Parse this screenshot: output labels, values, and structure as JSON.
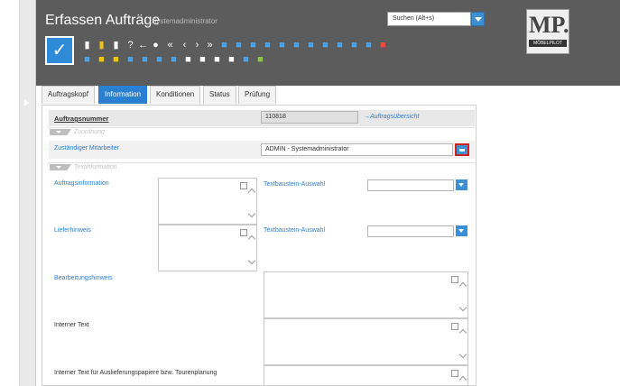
{
  "app": {
    "title": "Erfassen Aufträge",
    "subtitle": "Systemadministrator",
    "search_placeholder": "Suchen (Alt+s)",
    "logo_text": "MP.",
    "logo_wordmark": "MÖBELPILOT"
  },
  "toolbar": {
    "icons": [
      "new-icon",
      "copy-icon",
      "delete-icon",
      "help-icon",
      "back-icon",
      "search-icon",
      "first-icon",
      "previous-icon",
      "next-icon",
      "last-icon"
    ]
  },
  "tabs": [
    {
      "label": "Auftragskopf"
    },
    {
      "label": "Information"
    },
    {
      "label": "Konditionen"
    },
    {
      "label": "Status"
    },
    {
      "label": "Prüfung"
    }
  ],
  "form": {
    "order_number_label": "Auftragsnummer",
    "order_number_value": "110818",
    "order_overview_link": "→Auftragsübersicht",
    "section_assignment": "Zuordnung",
    "responsible_label": "Zuständiger Mitarbeiter",
    "responsible_value": "ADMIN - Systemadministrator",
    "section_text": "Textinformation",
    "order_info_label": "Auftragsinformation",
    "text_module_label_1": "Textbaustein-Auswahl",
    "delivery_note_label": "Lieferhinweis",
    "text_module_label_2": "Textbaustein-Auswahl",
    "processing_note_label": "Bearbeitungshinweis",
    "internal_text_label": "Interner Text",
    "internal_text_delivery_label": "Interner Text für Auslieferungspapiere bzw. Tourenplanung"
  },
  "colors": {
    "header_bg": "#5c5c5c",
    "accent": "#2a7fd0",
    "highlight": "#d0221b"
  }
}
